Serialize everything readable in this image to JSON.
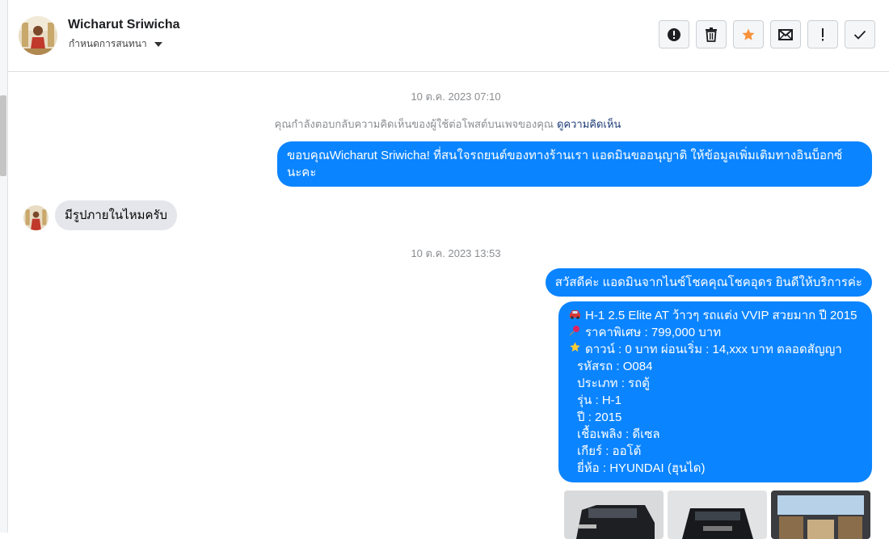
{
  "header": {
    "contact_name": "Wicharut Sriwicha",
    "subtitle": "กำหนดการสนทนา"
  },
  "actions": [
    {
      "name": "report-button",
      "icon": "alert-circle-icon"
    },
    {
      "name": "delete-button",
      "icon": "trash-icon"
    },
    {
      "name": "star-button",
      "icon": "star-icon"
    },
    {
      "name": "mark-unread-button",
      "icon": "envelope-icon"
    },
    {
      "name": "important-button",
      "icon": "exclamation-icon"
    },
    {
      "name": "done-button",
      "icon": "check-icon"
    }
  ],
  "conversation": {
    "timestamp_1": "10 ต.ค. 2023 07:10",
    "system_note": "คุณกำลังตอบกลับความคิดเห็นของผู้ใช้ต่อโพสต์บนเพจของคุณ",
    "system_link": "ดูความคิดเห็น",
    "msg_out_1_line1": "ขอบคุณWicharut Sriwicha! ที่สนใจรถยนต์ของทางร้านเรา แอดมินขออนุญาติ ให้ข้อมูลเพิ่มเติมทางอินบ็อกซ์",
    "msg_out_1_line2": "นะคะ",
    "msg_in_1": "มีรูปภายในไหมครับ",
    "timestamp_2": "10 ต.ค. 2023 13:53",
    "msg_out_2": "สวัสดีค่ะ แอดมินจากไนซ์โชคคุณโชคอุดร ยินดีให้บริการค่ะ",
    "details": {
      "title": "H-1 2.5 Elite AT ว้าวๆ รถแต่ง VVIP สวยมาก ปี 2015",
      "price": "ราคาพิเศษ : 799,000 บาท",
      "down": "ดาวน์ : 0 บาท ผ่อนเริ่ม : 14,xxx บาท ตลอดสัญญา",
      "code": "รหัสรถ : O084",
      "type": "ประเภท : รถตู้",
      "model": "รุ่น : H-1",
      "year": "ปี : 2015",
      "fuel": "เชื้อเพลิง : ดีเซล",
      "gear": "เกียร์ : ออโต้",
      "brand": "ยี่ห้อ : HYUNDAI (ฮุนได)"
    }
  },
  "colors": {
    "outgoing_bubble": "#0b84ff",
    "incoming_bubble": "#e4e6eb",
    "star": "#f7923a"
  }
}
